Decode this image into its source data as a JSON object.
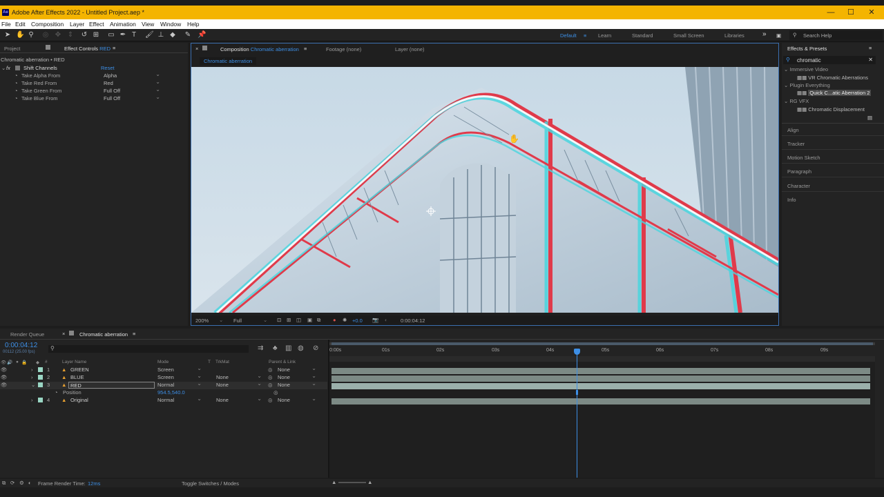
{
  "titlebar": {
    "app_icon": "Ae",
    "title": "Adobe After Effects 2022 - Untitled Project.aep *",
    "minimize": "—",
    "maximize": "☐",
    "close": "✕"
  },
  "menu": [
    "File",
    "Edit",
    "Composition",
    "Layer",
    "Effect",
    "Animation",
    "View",
    "Window",
    "Help"
  ],
  "workspaces": {
    "default": "Default",
    "learn": "Learn",
    "standard": "Standard",
    "small_screen": "Small Screen",
    "libraries": "Libraries",
    "more": "»",
    "search_help": "Search Help"
  },
  "project_tab": "Project",
  "effect_controls": {
    "tab_label": "Effect Controls",
    "tab_layer": "RED",
    "path": "Chromatic aberration • RED",
    "effect_name": "Shift Channels",
    "reset": "Reset",
    "params": [
      {
        "label": "Take Alpha From",
        "value": "Alpha"
      },
      {
        "label": "Take Red From",
        "value": "Red"
      },
      {
        "label": "Take Green From",
        "value": "Full Off"
      },
      {
        "label": "Take Blue From",
        "value": "Full Off"
      }
    ]
  },
  "comp": {
    "tab_label": "Composition",
    "tab_name": "Chromatic aberration",
    "footage_tab": "Footage  (none)",
    "layer_tab": "Layer  (none)",
    "breadcrumb": "Chromatic aberration",
    "zoom": "200%",
    "resolution": "Full",
    "exposure": "+0.0",
    "timecode": "0:00:04:12"
  },
  "effects_presets": {
    "title": "Effects & Presets",
    "search": "chromatic",
    "groups": [
      {
        "name": "Immersive Video",
        "items": [
          "VR Chromatic Aberrations"
        ]
      },
      {
        "name": "Plugin Everything",
        "items": [
          "Quick C...atic Aberration 2"
        ]
      },
      {
        "name": "RG VFX",
        "items": [
          "Chromatic Displacement"
        ]
      }
    ],
    "panels": [
      "Align",
      "Tracker",
      "Motion Sketch",
      "Paragraph",
      "Character",
      "Info"
    ]
  },
  "timeline": {
    "render_queue_tab": "Render Queue",
    "comp_tab": "Chromatic aberration",
    "timecode": "0:00:04:12",
    "frames_info": "00112 (25.00 fps)",
    "columns": {
      "layer_name": "Layer Name",
      "mode": "Mode",
      "t": "T",
      "trkmat": "TrkMat",
      "parent": "Parent & Link"
    },
    "layers": [
      {
        "num": "1",
        "name": "GREEN",
        "mode": "Screen",
        "trkmat": "",
        "parent": "None"
      },
      {
        "num": "2",
        "name": "BLUE",
        "mode": "Screen",
        "trkmat": "None",
        "parent": "None"
      },
      {
        "num": "3",
        "name": "RED",
        "mode": "Normal",
        "trkmat": "None",
        "parent": "None"
      },
      {
        "num": "4",
        "name": "Original",
        "mode": "Normal",
        "trkmat": "None",
        "parent": "None"
      }
    ],
    "position_label": "Position",
    "position_value": "954.5,540.0",
    "ruler": [
      "0:00s",
      "01s",
      "02s",
      "03s",
      "04s",
      "05s",
      "06s",
      "07s",
      "08s",
      "09s"
    ],
    "frame_render_label": "Frame Render Time:",
    "frame_render_value": "12ms",
    "toggle_label": "Toggle Switches / Modes"
  },
  "colors": {
    "accent": "#3d8fe6",
    "titlebar": "#f4b400",
    "track": "#7c8a85",
    "label_orange": "#e8a030"
  }
}
